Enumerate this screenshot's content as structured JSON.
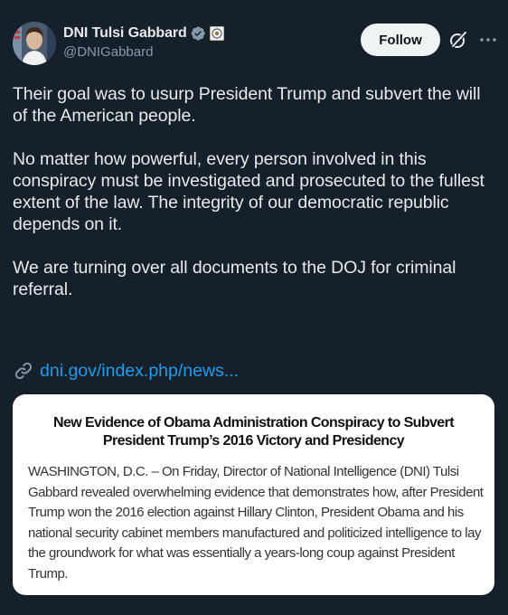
{
  "author": {
    "display_name": "DNI Tulsi Gabbard",
    "handle": "@DNIGabbard",
    "avatar": "avatar-photo",
    "verified_icon": "verified-badge-icon",
    "affiliate_icon": "government-seal-icon"
  },
  "actions": {
    "follow_label": "Follow",
    "grok_icon": "grok-icon",
    "more_icon": "more-options-icon"
  },
  "tweet": {
    "paragraphs": [
      "Their goal was to usurp President Trump and subvert the will of the American people.",
      "No matter how powerful, every person involved in this conspiracy must be investigated and prosecuted to the fullest extent of the law. The integrity of our democratic republic depends on it.",
      "We are turning over all documents to the DOJ for criminal referral."
    ],
    "link_text": "dni.gov/index.php/news...",
    "link_icon": "link-icon"
  },
  "card": {
    "title": "New Evidence of Obama Administration Conspiracy to Subvert President Trump’s 2016 Victory and Presidency",
    "body": "WASHINGTON, D.C. – On Friday, Director of National Intelligence (DNI) Tulsi Gabbard revealed overwhelming evidence that demonstrates how, after President Trump won the 2016 election against Hillary Clinton, President Obama and his national security cabinet members manufactured and politicized intelligence to lay the groundwork for what was essentially a years-long coup against President Trump."
  },
  "colors": {
    "background": "#15202b",
    "text": "#e7e9ea",
    "secondary_text": "#8b98a5",
    "link": "#1d9bf0",
    "verified": "#829aab"
  }
}
